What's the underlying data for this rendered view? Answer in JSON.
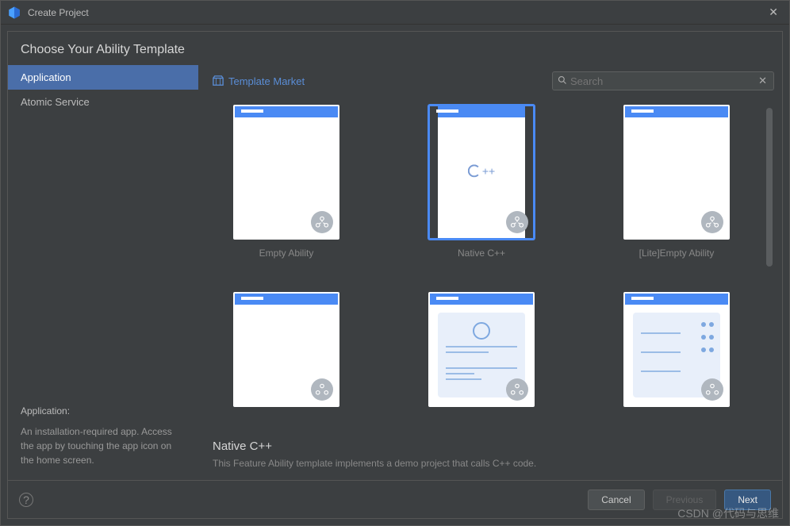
{
  "window": {
    "title": "Create Project"
  },
  "heading": "Choose Your Ability Template",
  "sidebar": {
    "items": [
      {
        "label": "Application",
        "selected": true
      },
      {
        "label": "Atomic Service",
        "selected": false
      }
    ],
    "description": {
      "title": "Application:",
      "text": "An installation-required app. Access the app by touching the app icon on the home screen."
    }
  },
  "main": {
    "market_link": "Template Market",
    "search": {
      "placeholder": "Search",
      "value": ""
    },
    "templates": [
      {
        "label": "Empty Ability",
        "kind": "empty",
        "selected": false
      },
      {
        "label": "Native C++",
        "kind": "cpp",
        "selected": true
      },
      {
        "label": "[Lite]Empty Ability",
        "kind": "empty",
        "selected": false
      },
      {
        "label": "",
        "kind": "empty",
        "selected": false
      },
      {
        "label": "",
        "kind": "list",
        "selected": false
      },
      {
        "label": "",
        "kind": "dots",
        "selected": false
      }
    ],
    "selected_detail": {
      "title": "Native C++",
      "desc": "This Feature Ability template implements a demo project that calls C++ code."
    }
  },
  "footer": {
    "cancel": "Cancel",
    "previous": "Previous",
    "next": "Next"
  },
  "watermark": "CSDN @代码与思维"
}
